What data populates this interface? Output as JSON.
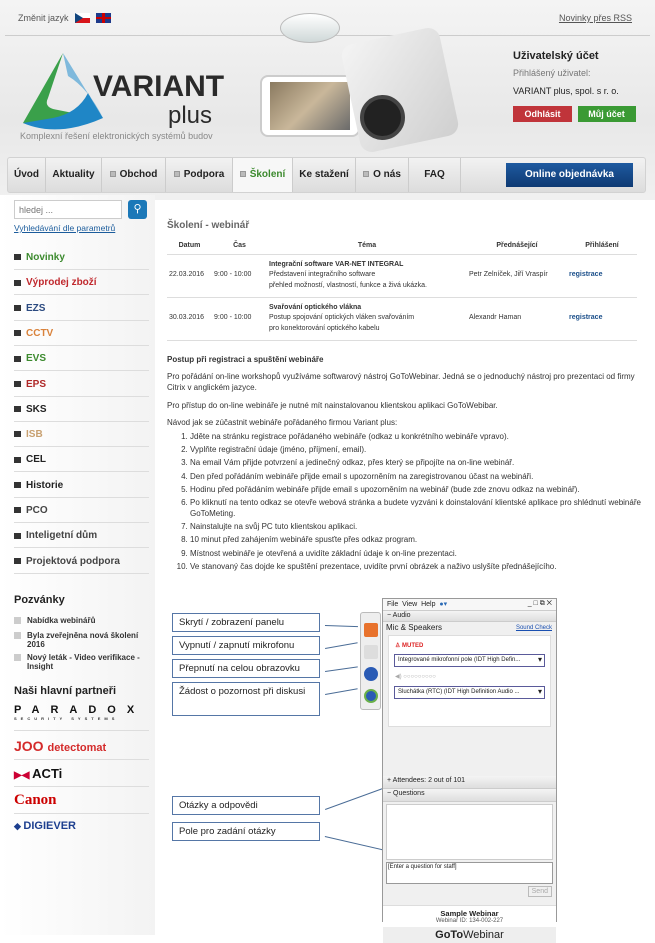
{
  "header": {
    "change_language": "Změnit jazyk",
    "rss": "Novinky přes RSS",
    "logo_text": "VARIANT",
    "logo_sub": "plus",
    "tagline": "Komplexní řešení elektronických systémů budov"
  },
  "account": {
    "title": "Uživatelský účet",
    "logged_label": "Přihlášený uživatel:",
    "company": "VARIANT plus, spol. s r. o.",
    "logout": "Odhlásit",
    "my_account": "Můj účet",
    "logout_color": "#c0343a",
    "account_color": "#3a9a34"
  },
  "nav": {
    "items": [
      "Úvod",
      "Aktuality",
      "Obchod",
      "Podpora",
      "Školení",
      "Ke stažení",
      "O nás",
      "FAQ"
    ],
    "online_order": "Online objednávka",
    "active": "Školení"
  },
  "sidebar": {
    "search_placeholder": "hledej ...",
    "param_search": "Vyhledávání dle parametrů",
    "categories": [
      {
        "label": "Novinky",
        "color": "#3c8a2e"
      },
      {
        "label": "Výprodej zboží",
        "color": "#c0282d"
      },
      {
        "label": "EZS",
        "color": "#2b4a80"
      },
      {
        "label": "CCTV",
        "color": "#d9823b"
      },
      {
        "label": "EVS",
        "color": "#3c8a2e"
      },
      {
        "label": "EPS",
        "color": "#b02828"
      },
      {
        "label": "SKS",
        "color": "#222222"
      },
      {
        "label": "ISB",
        "color": "#c8a070"
      },
      {
        "label": "CEL",
        "color": "#222222"
      },
      {
        "label": "Historie",
        "color": "#222222"
      },
      {
        "label": "PCO",
        "color": "#444444"
      },
      {
        "label": "Inteligetní dům",
        "color": "#444444"
      },
      {
        "label": "Projektová podpora",
        "color": "#444444"
      }
    ],
    "invites_title": "Pozvánky",
    "invites": [
      "Nabídka webinářů",
      "Byla zveřejněna nová školení 2016",
      "Nový leták - Video verifikace - Insight"
    ],
    "partners_title": "Naši hlavní partneři",
    "partners": [
      "PARADOX",
      "SECURITY SYSTEMS",
      "detectomat",
      "ACTi",
      "Canon",
      "DIGIEVER"
    ]
  },
  "main": {
    "title": "Školení - webinář",
    "table": {
      "headers": [
        "Datum",
        "Čas",
        "Téma",
        "Přednášející",
        "Přihlášení"
      ],
      "rows": [
        {
          "date": "22.03.2016",
          "time": "9:00 - 10:00",
          "topic": "Integrační software VAR-NET INTEGRAL",
          "desc1": "Představení integračního software",
          "desc2": "přehled možností, vlastností, funkce a živá ukázka.",
          "lecturer": "Petr Zelníček, Jiří Vraspír",
          "register": "registrace"
        },
        {
          "date": "30.03.2016",
          "time": "9:00 - 10:00",
          "topic": "Svařování optického vlákna",
          "desc1": "Postup spojování optických vláken svařováním",
          "desc2": "pro konektorování optického kabelu",
          "lecturer": "Alexandr Haman",
          "register": "registrace"
        }
      ]
    },
    "section_title": "Postup při registraci a spuštění webináře",
    "p1": "Pro pořádání on-line workshopů využíváme softwarový nástroj GoToWebinar. Jedná se o jednoduchý nástroj pro prezentaci od firmy Citrix v anglickém jazyce.",
    "p2": "Pro přístup do on-line webináře je nutné mít nainstalovanou klientskou aplikaci GoToWebibar.",
    "p3": "Návod jak se zúčastnit webináře pořádaného firmou Variant plus:",
    "steps": [
      "Jděte na stránku registrace pořádaného webináře  (odkaz u konkrétního webináře vpravo).",
      "Vyplňte registrační údaje (jméno, příjmení, email).",
      "Na email Vám přijde potvrzení a jedinečný odkaz, přes který se připojíte na on-line webinář.",
      "Den před pořádáním webináře přijde email s upozorněním na zaregistrovanou účast na webináři.",
      "Hodinu před pořádáním webináře přijde email s upozorněním na webinář (bude zde znovu odkaz na webinář).",
      "Po kliknutí na tento odkaz se otevře webová stránka a budete vyzváni k doinstalování klientské aplikace pro shlédnutí webináře GoToMeting.",
      "Nainstalujte na svůj PC tuto klientskou aplikaci.",
      "10 minut před zahájením webináře spusťte přes odkaz program.",
      "Místnost webináře je otevřená a uvidíte základní údaje k on-line prezentaci.",
      "Ve stanovaný čas dojde ke spuštění prezentace, uvidíte první obrázek a naživo uslyšíte přednášejícího."
    ]
  },
  "callouts": [
    "Skrytí / zobrazení panelu",
    "Vypnutí / zapnutí mikrofonu",
    "Přepnutí na celou obrazovku",
    "Žádost o pozornost při diskusi",
    "Otázky a odpovědi",
    "Pole pro zadání otázky"
  ],
  "gtw": {
    "menu": [
      "File",
      "View",
      "Help"
    ],
    "audio": "Audio",
    "mic_speakers": "Mic & Speakers",
    "sound_check": "Sound Check",
    "muted": "MUTED",
    "mic_device": "Integrované mikrofonní pole (IDT High Defin...",
    "speaker_device": "Sluchátka (RTC) (IDT High Definition Audio ...",
    "attendees": "Attendees:  2 out of 101",
    "questions": "Questions",
    "question_placeholder": "[Enter a question for staff]",
    "send": "Send",
    "webinar_name": "Sample Webinar",
    "webinar_id": "Webinar ID: 134-002-227",
    "brand_bold": "GoTo",
    "brand": "Webinar"
  }
}
